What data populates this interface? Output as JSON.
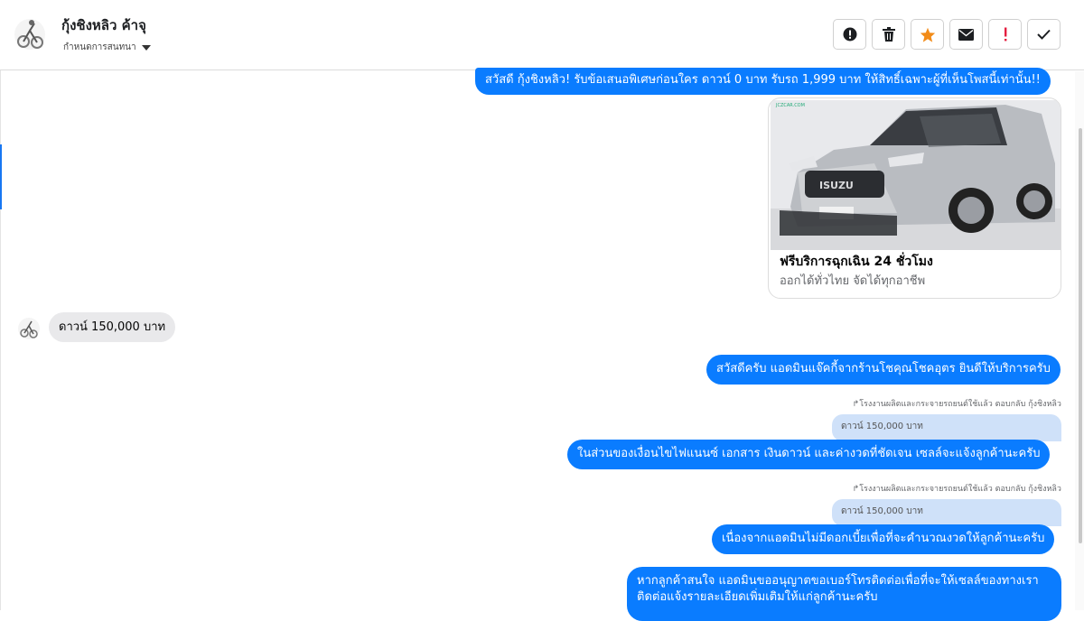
{
  "header": {
    "contact_name": "กุ้งชิงหลิว ค้าจุ",
    "subtitle": "กำหนดการสนทนา",
    "actions": [
      {
        "icon": "info-circle-icon",
        "label": ""
      },
      {
        "icon": "trash-icon",
        "label": ""
      },
      {
        "icon": "star-icon",
        "label": ""
      },
      {
        "icon": "mail-icon",
        "label": ""
      },
      {
        "icon": "exclamation-icon",
        "label": ""
      },
      {
        "icon": "check-icon",
        "label": ""
      }
    ]
  },
  "colors": {
    "outgoing_bubble": "#0a7cff",
    "incoming_bubble": "#e9e9eb",
    "quoted_bubble": "#cfe1f9",
    "star": "#f28b18",
    "alert": "#e41e3f"
  },
  "messages": {
    "promo": "สวัสดี กุ้งชิงหลิว! รับข้อเสนอพิเศษก่อนใคร ดาวน์ 0 บาท รับรถ 1,999 บาท ให้สิทธิ์เฉพาะผู้ที่เห็นโพสนี้เท่านั้น!!",
    "card_title": "ฟรีบริการฉุกเฉิน 24 ชั่วโมง",
    "card_subtitle": "ออกได้ทั่วไทย จัดได้ทุกอาชีพ",
    "card_image_caption": "ISUZU",
    "customer_msg": "ดาวน์ 150,000 บาท",
    "greeting_reply": "สวัสดีครับ แอดมินแจ๊คกี้จากร้านโชคุณโชคอุตร ยินดีให้บริการครับ",
    "reply_note_1": "โรงงานผลิตและกระจายรถยนต์ใช้แล้ว ตอบกลับ กุ้งชิงหลิว",
    "quoted_1": "ดาวน์ 150,000 บาท",
    "reply_1": "ในส่วนของเงื่อนไขไฟแนนซ์ เอกสาร เงินดาวน์ และค่างวดที่ชัดเจน เซลล์จะแจ้งลูกค้านะครับ",
    "reply_note_2": "โรงงานผลิตและกระจายรถยนต์ใช้แล้ว ตอบกลับ กุ้งชิงหลิว",
    "quoted_2": "ดาวน์ 150,000 บาท",
    "reply_2": "เนื่องจากแอดมินไม่มีดอกเบี้ยเพื่อที่จะคำนวณงวดให้ลูกค้านะครับ",
    "last_line_1": "หากลูกค้าสนใจ แอดมินขออนุญาตขอเบอร์โทรติดต่อเพื่อที่จะให้เซลล์ของทางเรา",
    "last_line_2": "ติดต่อแจ้งรายละเอียดเพิ่มเติมให้แก่ลูกค้านะครับ"
  }
}
